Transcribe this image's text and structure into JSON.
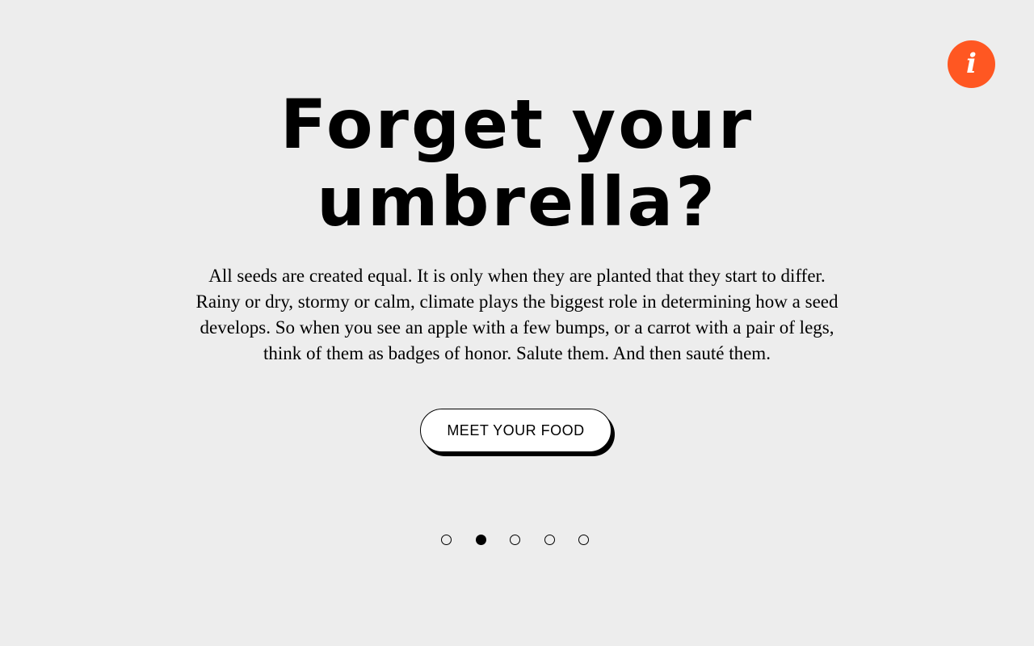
{
  "info_button": {
    "icon": "info-icon",
    "glyph": "i",
    "color": "#ff5722"
  },
  "hero": {
    "headline_lines": [
      "Forget your",
      "umbrella?"
    ],
    "body_lines": [
      "All seeds are created equal. It is only when they are planted that they start to differ.",
      "Rainy or dry, stormy or calm, climate plays the biggest role in determining how a seed",
      "develops. So when you see an apple with a few bumps, or a carrot with a pair of legs,",
      "think of them as badges of honor. Salute them. And then sauté them."
    ],
    "cta_label": "MEET YOUR FOOD"
  },
  "carousel": {
    "total": 5,
    "active_index": 1
  },
  "colors": {
    "background": "#ededed",
    "accent": "#ff5722",
    "text": "#000000"
  }
}
